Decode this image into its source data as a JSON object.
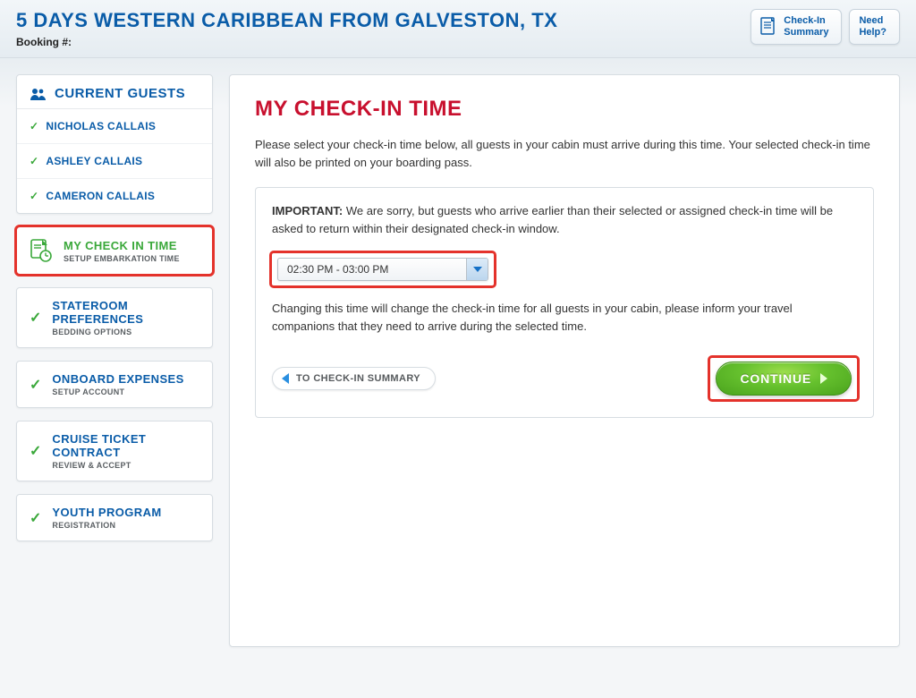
{
  "header": {
    "cruise_title": "5 DAYS WESTERN CARIBBEAN FROM GALVESTON, TX",
    "booking_label": "Booking #:",
    "checkin_summary_label": "Check-In\nSummary",
    "need_help_label": "Need\nHelp?"
  },
  "sidebar": {
    "guests_title": "CURRENT GUESTS",
    "guests": [
      {
        "name": "NICHOLAS CALLAIS"
      },
      {
        "name": "ASHLEY CALLAIS"
      },
      {
        "name": "CAMERON CALLAIS"
      }
    ],
    "steps": [
      {
        "title": "MY CHECK IN TIME",
        "subtitle": "SETUP EMBARKATION TIME",
        "active": true
      },
      {
        "title": "STATEROOM PREFERENCES",
        "subtitle": "BEDDING OPTIONS",
        "active": false
      },
      {
        "title": "ONBOARD EXPENSES",
        "subtitle": "SETUP ACCOUNT",
        "active": false
      },
      {
        "title": "CRUISE TICKET CONTRACT",
        "subtitle": "REVIEW & ACCEPT",
        "active": false
      },
      {
        "title": "YOUTH PROGRAM",
        "subtitle": "REGISTRATION",
        "active": false
      }
    ]
  },
  "main": {
    "title": "MY CHECK-IN TIME",
    "lead": "Please select your check-in time below, all guests in your cabin must arrive during this time.   Your selected check-in time will also be printed on your boarding pass.",
    "important_label": "IMPORTANT:",
    "important_text": " We are sorry, but guests who arrive earlier than their selected or assigned check-in time will be asked to return within their designated check-in window.",
    "time_selected": "02:30 PM - 03:00 PM",
    "change_note": "Changing this time will change the check-in time for all guests in your cabin, please inform your travel companions that they need to arrive during the selected time.",
    "back_label": "TO CHECK-IN SUMMARY",
    "continue_label": "CONTINUE"
  }
}
